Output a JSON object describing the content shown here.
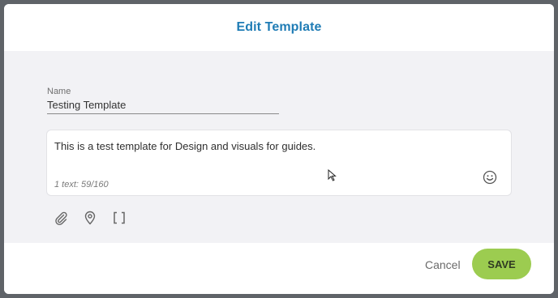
{
  "dialog": {
    "title": "Edit Template"
  },
  "form": {
    "name_label": "Name",
    "name_value": "Testing Template",
    "message_text": "This is a test template for Design and visuals for guides.",
    "counter": "1 text: 59/160"
  },
  "icons": {
    "emoji": "smiley-face-icon",
    "attach": "paperclip-icon",
    "location": "map-pin-icon",
    "placeholder": "brackets-icon"
  },
  "footer": {
    "cancel_label": "Cancel",
    "save_label": "SAVE"
  },
  "colors": {
    "title": "#1f7cb5",
    "save_button": "#9ccc50",
    "body_background": "#f2f2f5"
  }
}
